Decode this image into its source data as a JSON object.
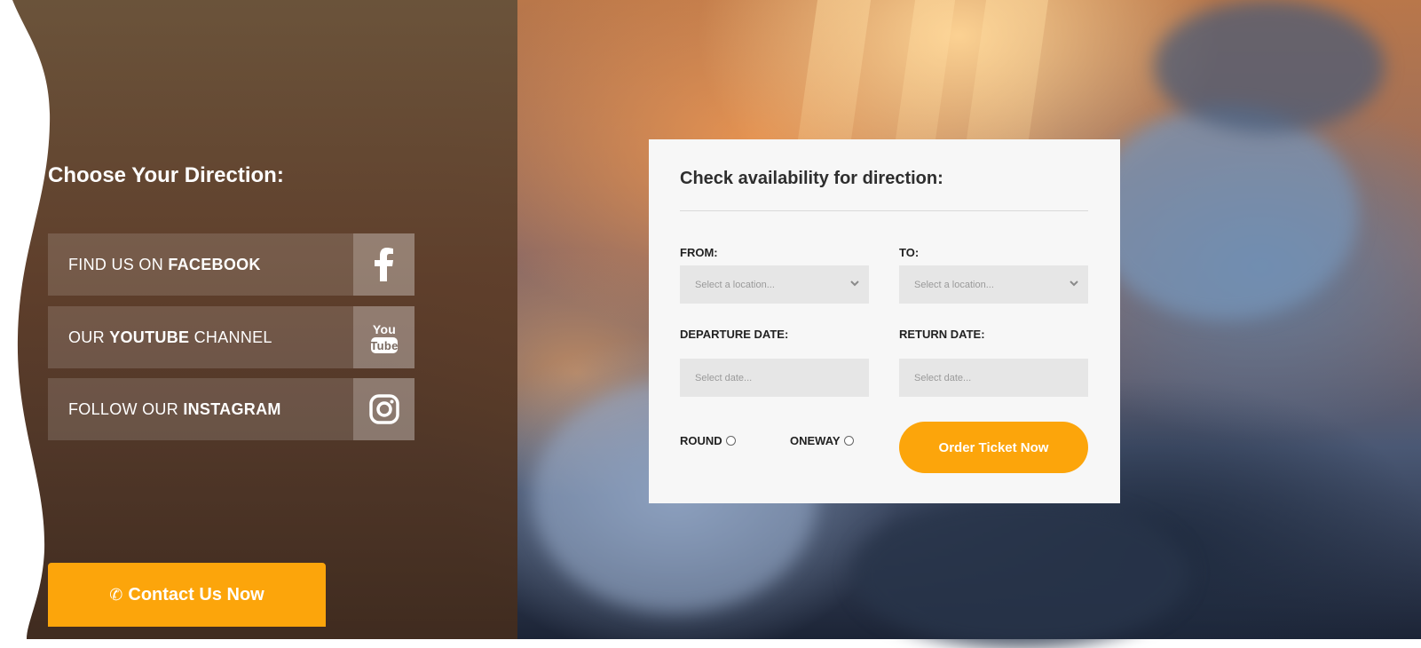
{
  "sidebar": {
    "title": "Choose Your Direction:",
    "social": [
      {
        "prefix": "FIND US ON ",
        "bold": "FACEBOOK",
        "suffix": "",
        "icon": "facebook-icon"
      },
      {
        "prefix": "OUR ",
        "bold": "YOUTUBE",
        "suffix": " CHANNEL",
        "icon": "youtube-icon",
        "icon_text_top": "You",
        "icon_text_bottom": "Tube"
      },
      {
        "prefix": "FOLLOW OUR ",
        "bold": "INSTAGRAM",
        "suffix": "",
        "icon": "instagram-icon"
      }
    ],
    "contact_label": "Contact Us Now"
  },
  "booking": {
    "title": "Check availability for direction:",
    "from_label": "FROM:",
    "to_label": "TO:",
    "from_placeholder": "Select a location...",
    "to_placeholder": "Select a location...",
    "departure_label": "DEPARTURE DATE:",
    "return_label": "RETURN DATE:",
    "departure_placeholder": "Select date...",
    "return_placeholder": "Select date...",
    "round_label": "ROUND",
    "oneway_label": "ONEWAY",
    "order_label": "Order Ticket Now"
  },
  "colors": {
    "accent": "#fca50b",
    "panel": "#5c3c28",
    "card": "#f7f7f7"
  }
}
